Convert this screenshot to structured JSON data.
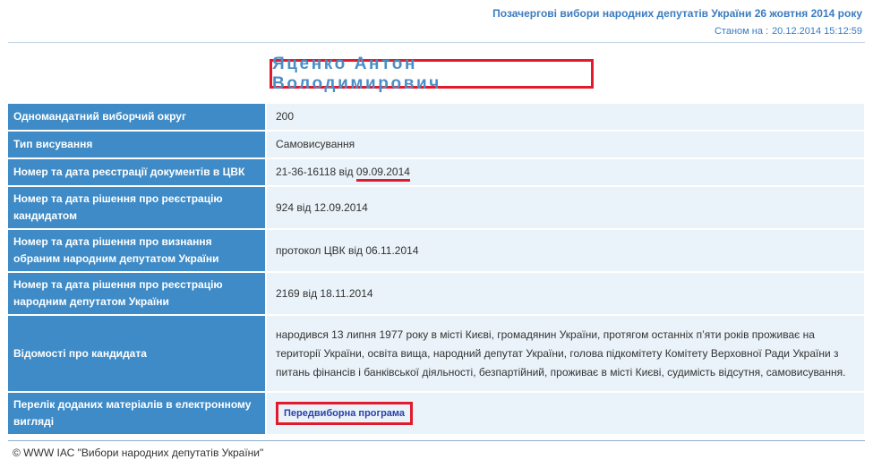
{
  "header": {
    "election_title": "Позачергові вибори народних депутатів України 26 жовтня 2014 року",
    "status_label": "Станом на :",
    "status_date": "20.12.2014 15:12:59"
  },
  "candidate": {
    "name": "Яценко Антон Володимирович"
  },
  "rows": [
    {
      "label": "Одномандатний виборчий округ",
      "value": "200"
    },
    {
      "label": "Тип висування",
      "value": "Самовисування"
    },
    {
      "label": "Номер та дата реєстрації документів в ЦВК",
      "value_prefix": "21-36-16118 від ",
      "value_date": "09.09.2014"
    },
    {
      "label": "Номер та дата рішення про реєстрацію кандидатом",
      "value": "924 від 12.09.2014"
    },
    {
      "label": "Номер та дата рішення про визнання обраним народним депутатом України",
      "value": "протокол ЦВК від 06.11.2014"
    },
    {
      "label": "Номер та дата рішення про реєстрацію народним депутатом України",
      "value": "2169 від 18.11.2014"
    },
    {
      "label": "Відомості про кандидата",
      "value": "народився 13 липня 1977 року в місті Києві, громадянин України, протягом останніх п’яти років проживає на території України, освіта вища, народний депутат України, голова підкомітету Комітету Верховної Ради України з питань фінансів і банківської діяльності, безпартійний, проживає в місті Києві, судимість відсутня, самовисування."
    },
    {
      "label": "Перелік доданих матеріалів в електронному вигляді",
      "link_label": "Передвиборна програма"
    }
  ],
  "footer": {
    "copyright": "© WWW ІАС \"Вибори народних депутатів України\""
  }
}
